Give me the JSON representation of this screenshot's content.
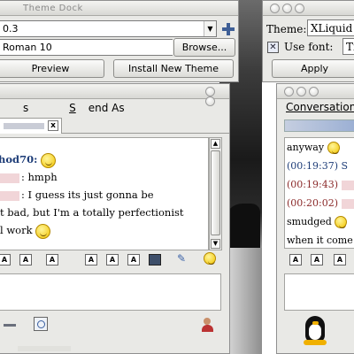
{
  "theme_dock": {
    "title": "Theme Dock",
    "version_value": "0.3",
    "font_value": "Roman 10",
    "browse_label": "Browse...",
    "preview_label": "Preview",
    "install_label": "Install New Theme"
  },
  "chat_left": {
    "menu": [
      {
        "pre": "",
        "u": "",
        "post": "s"
      },
      {
        "pre": "",
        "u": "S",
        "post": "end As"
      }
    ],
    "tab_close": "x",
    "messages": [
      {
        "text": "hod70:",
        "kind": "nick"
      },
      {
        "text": ": hmph",
        "kind": "line"
      },
      {
        "text": ": I guess its just gonna be",
        "kind": "line"
      },
      {
        "text": "t bad, but I'm a totally perfectionist",
        "kind": "plain"
      },
      {
        "text": "l work",
        "kind": "plain"
      }
    ],
    "format_buttons": [
      "A",
      "A",
      "A",
      "A",
      "A",
      "A"
    ]
  },
  "theme_panel": {
    "theme_label": "Theme:",
    "theme_value": "XLiquid",
    "use_font_label": "Use font:",
    "use_font_checked": "✕",
    "font_value": "Ti",
    "apply_label": "Apply"
  },
  "chat_right": {
    "menu_conversation": "Conversation",
    "messages": [
      {
        "text": "anyway",
        "color": "#000000"
      },
      {
        "text": "(00:19:37) S",
        "color": "#1e3d78"
      },
      {
        "text": "(00:19:43)",
        "color": "#8b2a2a"
      },
      {
        "text": "(00:20:02)",
        "color": "#8b2a2a"
      },
      {
        "text": "smudged",
        "color": "#000000"
      },
      {
        "text": "when it come",
        "color": "#000000"
      }
    ],
    "format_buttons": [
      "A",
      "A",
      "A"
    ]
  }
}
